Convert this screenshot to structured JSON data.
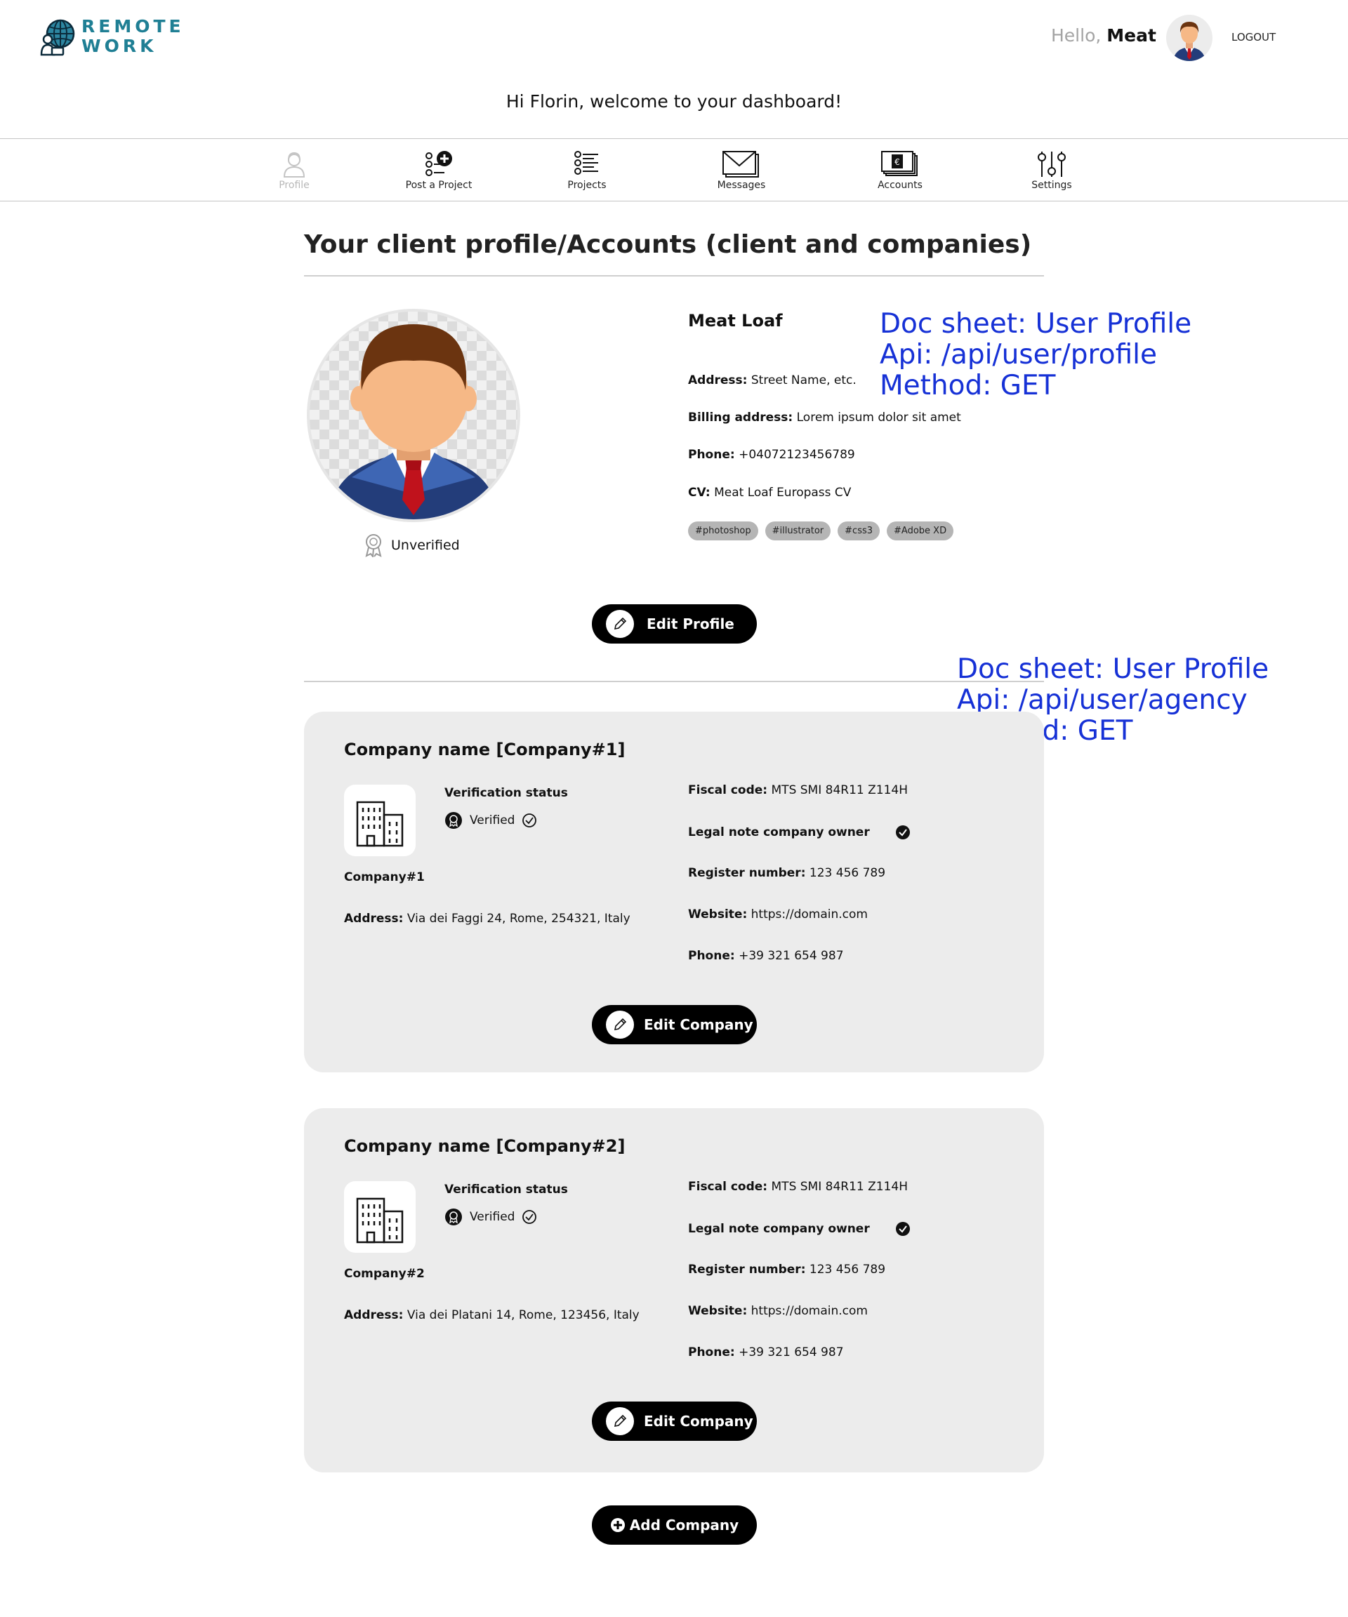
{
  "header": {
    "logo_line1": "REMOTE",
    "logo_line2": "WORK",
    "hello_prefix": "Hello,",
    "hello_name": "Meat",
    "logout": "LOGOUT",
    "welcome": "Hi Florin, welcome to your dashboard!"
  },
  "nav": [
    {
      "label": "Profile",
      "icon": "profile-icon",
      "disabled": true
    },
    {
      "label": "Post a Project",
      "icon": "post-project-icon",
      "disabled": false
    },
    {
      "label": "Projects",
      "icon": "projects-icon",
      "disabled": false
    },
    {
      "label": "Messages",
      "icon": "messages-icon",
      "disabled": false
    },
    {
      "label": "Accounts",
      "icon": "accounts-icon",
      "disabled": false
    },
    {
      "label": "Settings",
      "icon": "settings-icon",
      "disabled": false
    }
  ],
  "page_title": "Your client profile/Accounts (client and companies)",
  "profile": {
    "name": "Meat Loaf",
    "status": "Unverified",
    "address_label": "Address:",
    "address": "Street Name, etc.",
    "billing_label": "Billing address:",
    "billing": "Lorem ipsum dolor sit amet",
    "phone_label": "Phone:",
    "phone": "+04072123456789",
    "cv_label": "CV:",
    "cv": "Meat Loaf Europass CV",
    "tags": [
      "#photoshop",
      "#illustrator",
      "#css3",
      "#Adobe XD"
    ],
    "edit_button": "Edit Profile"
  },
  "notes": {
    "profile": [
      "Doc sheet: User Profile",
      "Api: /api/user/profile",
      "Method: GET"
    ],
    "agency": [
      "Doc sheet: User Profile",
      "Api: /api/user/agency",
      "Method: GET"
    ]
  },
  "companies": [
    {
      "title": "Company name [Company#1]",
      "short": "Company#1",
      "verification_label": "Verification status",
      "verification": "Verified",
      "address_label": "Address:",
      "address": "Via dei Faggi 24, Rome, 254321, Italy",
      "fiscal_label": "Fiscal code:",
      "fiscal": "MTS SMI 84R11 Z114H",
      "legal_label": "Legal note company owner",
      "register_label": "Register number:",
      "register": "123 456 789",
      "website_label": "Website:",
      "website": "https://domain.com",
      "phone_label": "Phone:",
      "phone": "+39 321 654 987",
      "edit_button": "Edit Company"
    },
    {
      "title": "Company name [Company#2]",
      "short": "Company#2",
      "verification_label": "Verification status",
      "verification": "Verified",
      "address_label": "Address:",
      "address": "Via dei Platani 14, Rome, 123456, Italy",
      "fiscal_label": "Fiscal code:",
      "fiscal": "MTS SMI 84R11 Z114H",
      "legal_label": "Legal note company owner",
      "register_label": "Register number:",
      "register": "123 456 789",
      "website_label": "Website:",
      "website": "https://domain.com",
      "phone_label": "Phone:",
      "phone": "+39 321 654 987",
      "edit_button": "Edit Company"
    }
  ],
  "add_company": "Add Company",
  "colors": {
    "brand": "#1f7f94",
    "note": "#1631d6",
    "card": "#ececec",
    "button": "#000000"
  }
}
